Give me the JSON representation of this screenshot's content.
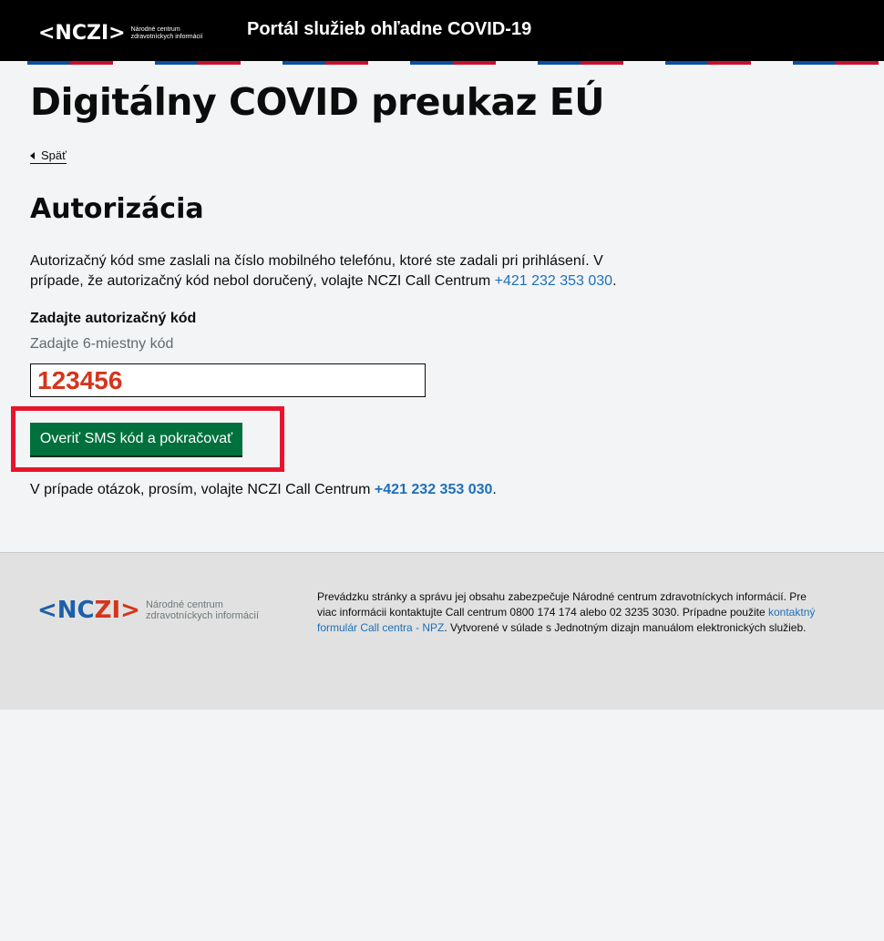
{
  "header": {
    "logo_mark": "<NCZI>",
    "logo_sub_line1": "Národné centrum",
    "logo_sub_line2": "zdravotníckych informácií",
    "title": "Portál služieb ohľadne COVID-19"
  },
  "colors": {
    "stripe_blue": "#0b4ea2",
    "stripe_red": "#c8102e",
    "button_green": "#00703c",
    "link_blue": "#1d70b8",
    "highlight_red": "#e8142c"
  },
  "page": {
    "title": "Digitálny COVID preukaz EÚ",
    "back_label": "Späť",
    "section_title": "Autorizácia",
    "description": "Autorizačný kód sme zaslali na číslo mobilného telefónu, ktoré ste zadali pri prihlásení. V prípade, že autorizačný kód nebol doručený, volajte NCZI Call Centrum ",
    "description_phone": "+421 232 353 030",
    "description_end": ".",
    "field_label": "Zadajte autorizačný kód",
    "field_hint": "Zadajte 6-miestny kód",
    "code_value": "123456",
    "submit_label": "Overiť SMS kód a pokračovať",
    "help_prefix": "V prípade otázok, prosím, volajte NCZI Call Centrum ",
    "help_phone": "+421 232 353 030",
    "help_suffix": "."
  },
  "footer": {
    "logo_mark_left": "<NC",
    "logo_mark_right": "ZI>",
    "logo_sub_line1": "Národné centrum",
    "logo_sub_line2": "zdravotníckych informácií",
    "text_before_link": "Prevádzku stránky a správu jej obsahu zabezpečuje Národné centrum zdravotníckych informácií. Pre viac informácii kontaktujte Call centrum 0800 174 174 alebo 02 3235 3030. Prípadne použite ",
    "link_text": "kontaktný formulár Call centra - NPZ",
    "text_after_link": ". Vytvorené v súlade s Jednotným dizajn manuálom elektronických služieb."
  }
}
